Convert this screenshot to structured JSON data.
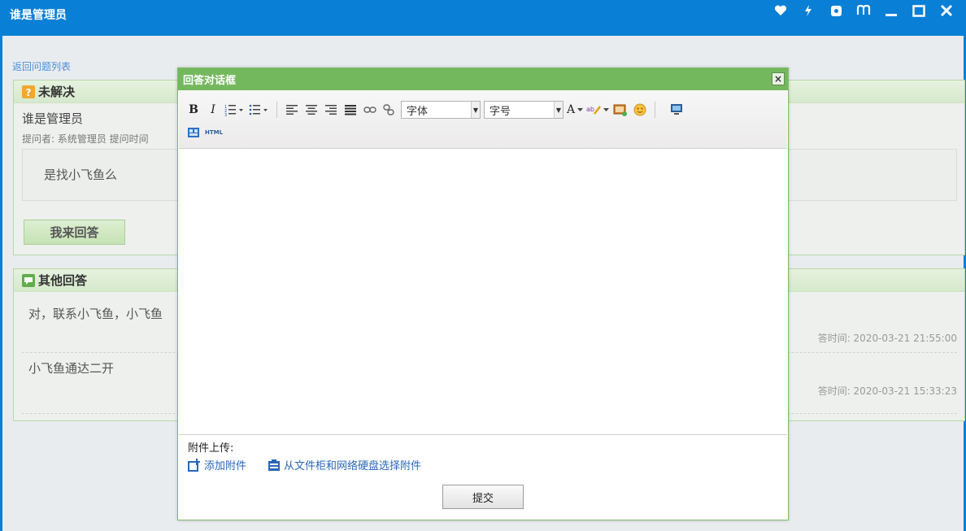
{
  "window": {
    "title": "谁是管理员"
  },
  "back_link": "返回问题列表",
  "question": {
    "status": "未解决",
    "title": "谁是管理员",
    "meta": "提问者: 系统管理员  提问时间",
    "body": "是找小飞鱼么",
    "answer_button": "我来回答"
  },
  "other_answers": {
    "title": "其他回答",
    "items": [
      {
        "text": "对，联系小飞鱼，小飞鱼",
        "time": "答时间: 2020-03-21 21:55:00"
      },
      {
        "text": "小飞鱼通达二开",
        "time": "答时间: 2020-03-21 15:33:23"
      }
    ]
  },
  "dialog": {
    "title": "回答对话框",
    "close": "×",
    "toolbar": {
      "bold": "B",
      "italic": "I",
      "font_select": "字体",
      "size_select": "字号",
      "font_color": "A",
      "html": "HTML"
    },
    "attach_label": "附件上传:",
    "add_attachment": "添加附件",
    "select_attachment": "从文件柜和网络硬盘选择附件",
    "submit": "提交"
  },
  "colors": {
    "titlebar": "#0a7fd6",
    "dialog_header": "#74b85e",
    "link": "#2966b8"
  }
}
